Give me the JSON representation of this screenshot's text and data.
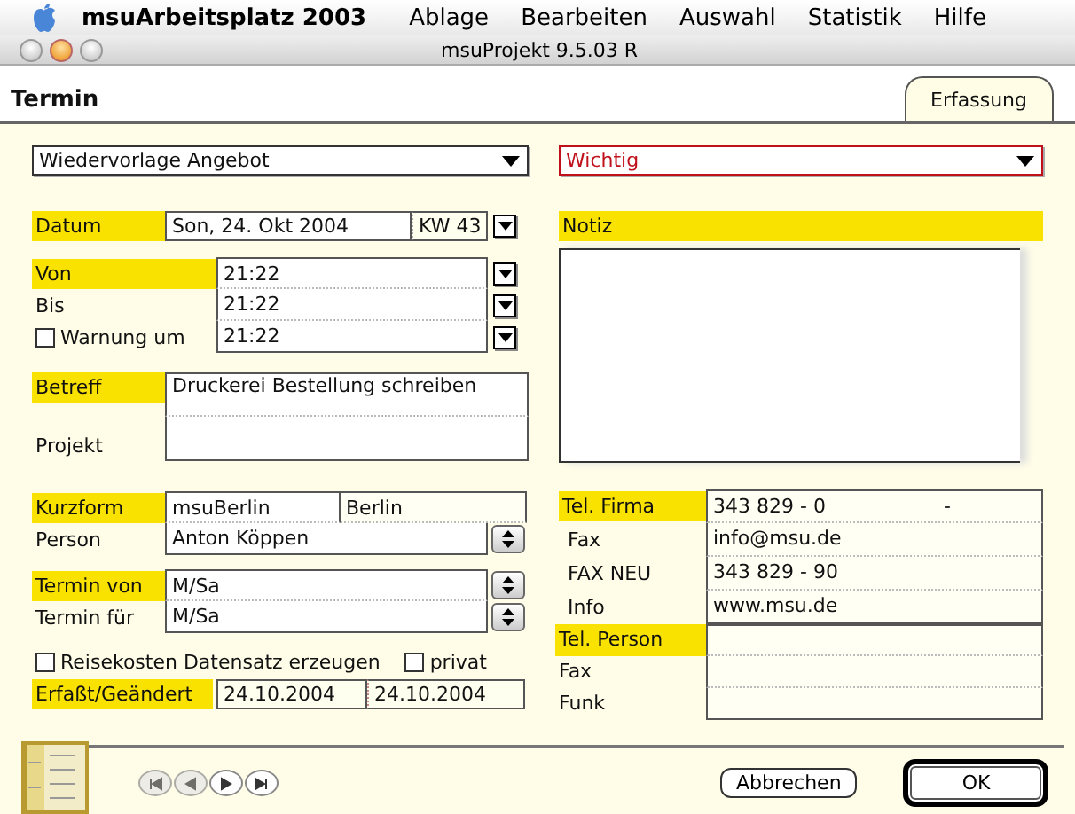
{
  "menu_bar": {
    "app_name": "msuArbeitsplatz 2003",
    "items": [
      "Ablage",
      "Bearbeiten",
      "Auswahl",
      "Statistik",
      "Hilfe"
    ]
  },
  "window": {
    "title": "msuProjekt 9.5.03 R"
  },
  "header": {
    "title": "Termin"
  },
  "tabs": [
    {
      "label": "Erfassung",
      "selected": true
    }
  ],
  "type_dropdown": {
    "value": "Wiedervorlage Angebot"
  },
  "priority_dropdown": {
    "value": "Wichtig"
  },
  "date": {
    "label": "Datum",
    "highlighted": true,
    "value": "Son, 24. Okt 2004",
    "week": "KW 43"
  },
  "times": [
    {
      "kind": "plain",
      "label": "Von",
      "highlighted": true,
      "value": "21:22"
    },
    {
      "kind": "plain",
      "label": "Bis",
      "highlighted": false,
      "value": "21:22"
    },
    {
      "kind": "checkbox",
      "label": "Warnung um",
      "highlighted": false,
      "checked": false,
      "value": "21:22"
    }
  ],
  "subject": [
    {
      "label": "Betreff",
      "highlighted": true,
      "value": "Druckerei Bestellung schreiben"
    },
    {
      "label": "Projekt",
      "highlighted": false
    }
  ],
  "company": {
    "label": "Kurzform",
    "highlighted": true,
    "value": "msuBerlin",
    "city": "Berlin"
  },
  "person": {
    "label": "Person",
    "highlighted": false,
    "value": "Anton Köppen"
  },
  "assignment": [
    {
      "label": "Termin von",
      "highlighted": true,
      "value": "M/Sa"
    },
    {
      "label": "Termin für",
      "highlighted": false,
      "value": "M/Sa"
    }
  ],
  "options": [
    {
      "label": "Reisekosten Datensatz erzeugen",
      "checked": false
    },
    {
      "label": "privat",
      "checked": false
    }
  ],
  "record": {
    "label": "Erfaßt/Geändert",
    "highlighted": true,
    "created": "24.10.2004",
    "changed": "24.10.2004"
  },
  "note": {
    "label": "Notiz",
    "highlighted": true
  },
  "company_phones": [
    {
      "label": "Tel. Firma",
      "highlighted": true,
      "value": "343 829 - 0",
      "extension": "-"
    },
    {
      "label": "Fax",
      "highlighted": false,
      "value": "info@msu.de"
    },
    {
      "label": "FAX NEU",
      "highlighted": false,
      "value": "343 829 - 90"
    },
    {
      "label": "Info",
      "highlighted": false,
      "value": "www.msu.de"
    }
  ],
  "person_phones": [
    {
      "label": "Tel. Person",
      "highlighted": true
    },
    {
      "label": "Fax",
      "highlighted": false
    },
    {
      "label": "Funk",
      "highlighted": false
    }
  ],
  "record_nav": [
    {
      "kind": "first",
      "disabled": true
    },
    {
      "kind": "prev",
      "disabled": true
    },
    {
      "kind": "next",
      "disabled": false
    },
    {
      "kind": "last",
      "disabled": false
    }
  ],
  "buttons": [
    {
      "label": "Abbrechen",
      "default": false
    },
    {
      "label": "OK",
      "default": true
    }
  ]
}
